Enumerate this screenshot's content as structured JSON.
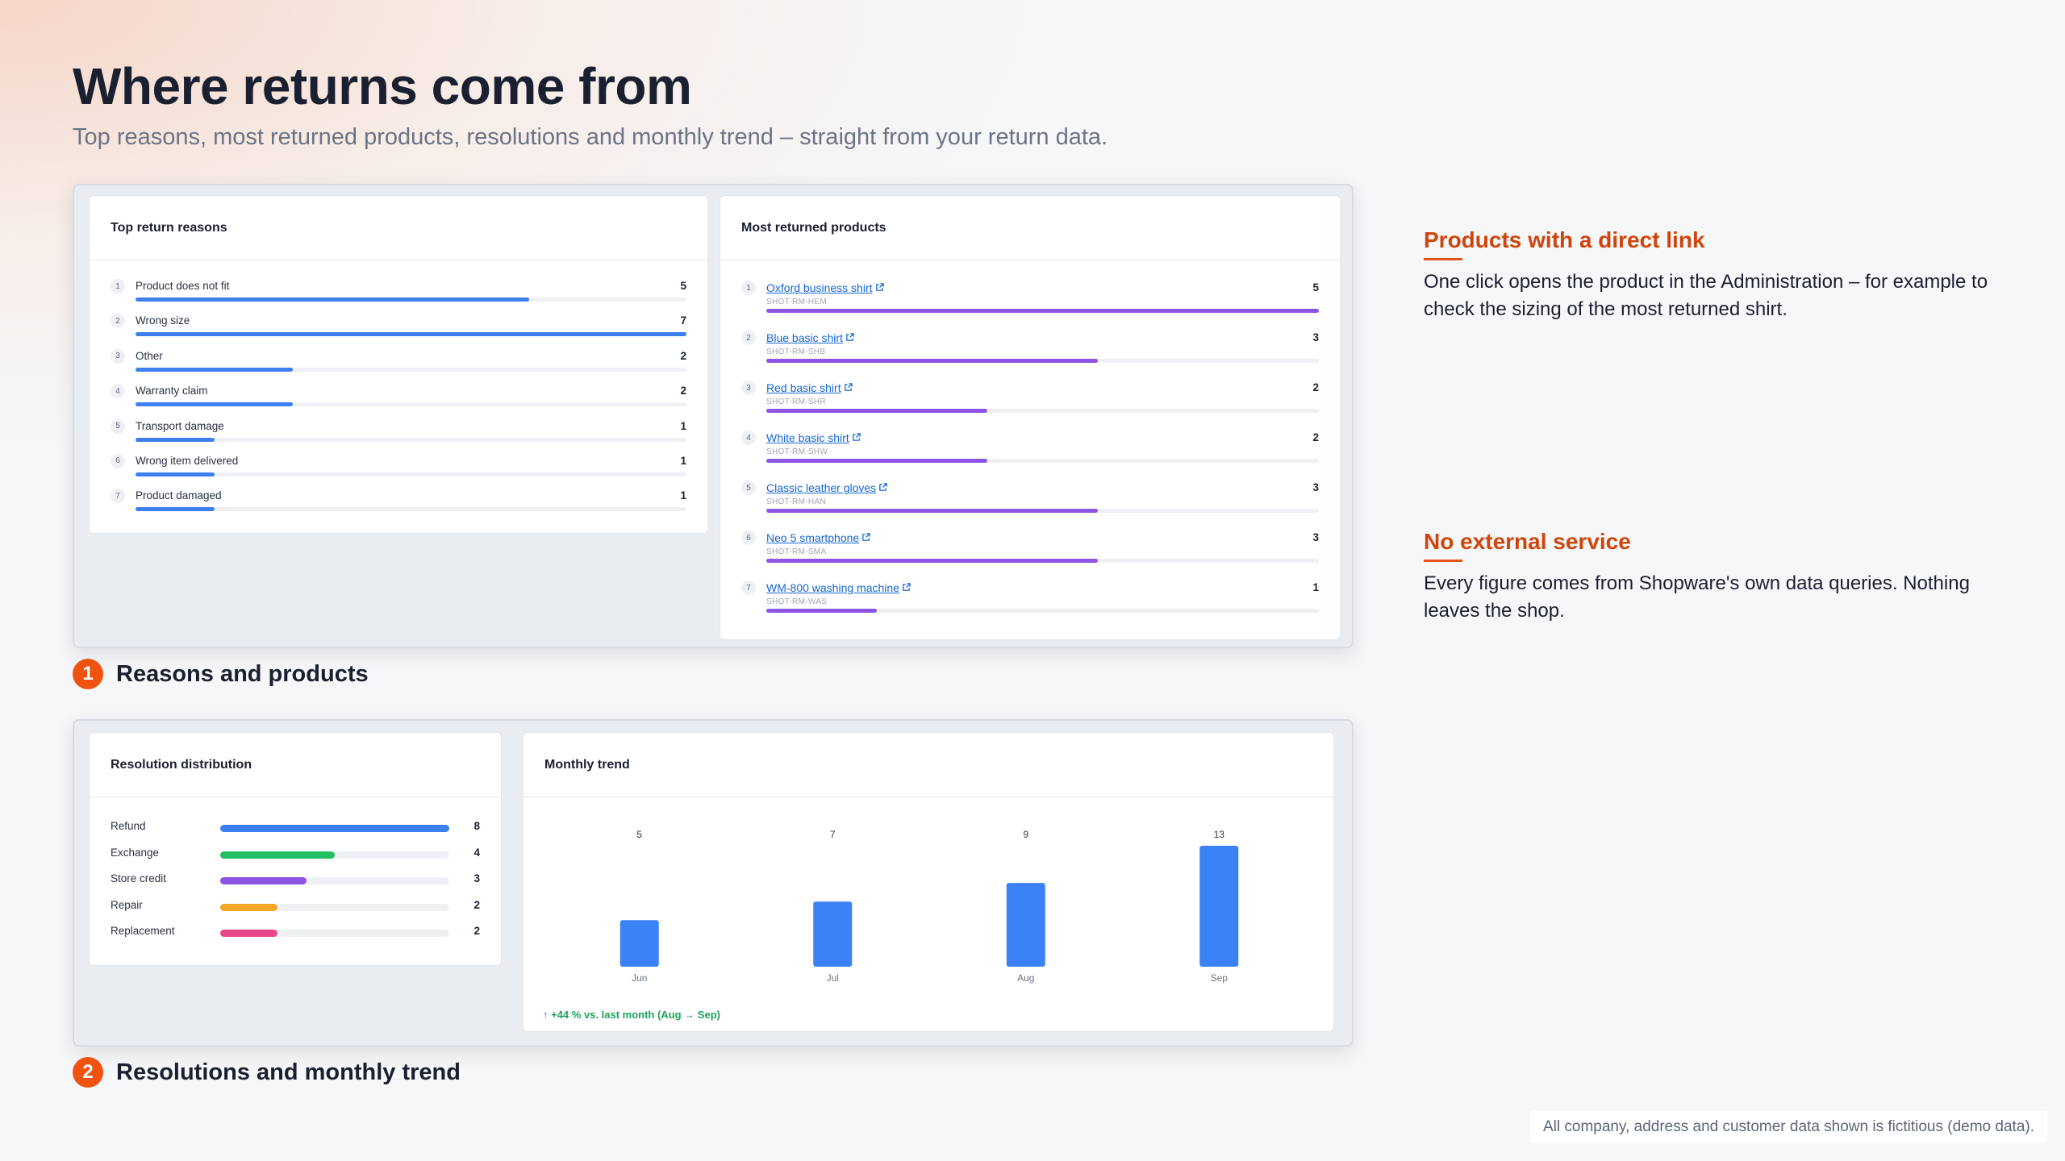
{
  "header": {
    "title": "Where returns come from",
    "subtitle": "Top reasons, most returned products, resolutions and monthly trend – straight from your return data."
  },
  "reasons": {
    "title": "Top return reasons",
    "max": 7,
    "color": "#3b7ff0",
    "items": [
      {
        "rank": "1",
        "label": "Product does not fit",
        "value": 5
      },
      {
        "rank": "2",
        "label": "Wrong size",
        "value": 7
      },
      {
        "rank": "3",
        "label": "Other",
        "value": 2
      },
      {
        "rank": "4",
        "label": "Warranty claim",
        "value": 2
      },
      {
        "rank": "5",
        "label": "Transport damage",
        "value": 1
      },
      {
        "rank": "6",
        "label": "Wrong item delivered",
        "value": 1
      },
      {
        "rank": "7",
        "label": "Product damaged",
        "value": 1
      }
    ]
  },
  "products": {
    "title": "Most returned products",
    "max": 5,
    "color": "#8d55e6",
    "items": [
      {
        "rank": "1",
        "name": "Oxford business shirt",
        "sku": "SHOT-RM-HEM",
        "value": 5
      },
      {
        "rank": "2",
        "name": "Blue basic shirt",
        "sku": "SHOT-RM-SHB",
        "value": 3
      },
      {
        "rank": "3",
        "name": "Red basic shirt",
        "sku": "SHOT-RM-SHR",
        "value": 2
      },
      {
        "rank": "4",
        "name": "White basic shirt",
        "sku": "SHOT-RM-SHW",
        "value": 2
      },
      {
        "rank": "5",
        "name": "Classic leather gloves",
        "sku": "SHOT-RM-HAN",
        "value": 3
      },
      {
        "rank": "6",
        "name": "Neo 5 smartphone",
        "sku": "SHOT-RM-SMA",
        "value": 3
      },
      {
        "rank": "7",
        "name": "WM-800 washing machine",
        "sku": "SHOT-RM-WAS",
        "value": 1
      }
    ]
  },
  "resolutions": {
    "title": "Resolution distribution",
    "max": 8,
    "items": [
      {
        "label": "Refund",
        "value": 8,
        "color": "#3b7ff0"
      },
      {
        "label": "Exchange",
        "value": 4,
        "color": "#22c062"
      },
      {
        "label": "Store credit",
        "value": 3,
        "color": "#8d55e6"
      },
      {
        "label": "Repair",
        "value": 2,
        "color": "#f5a623"
      },
      {
        "label": "Replacement",
        "value": 2,
        "color": "#e8478b"
      }
    ]
  },
  "trend": {
    "title": "Monthly trend",
    "note": "↑  +44 % vs. last month (Aug → Sep)"
  },
  "chart_data": {
    "type": "bar",
    "categories": [
      "Jun",
      "Jul",
      "Aug",
      "Sep"
    ],
    "values": [
      5,
      7,
      9,
      13
    ],
    "ylim": [
      0,
      13
    ],
    "color": "#3b82f6",
    "grid": false
  },
  "steps": [
    {
      "num": "1",
      "label": "Reasons and products"
    },
    {
      "num": "2",
      "label": "Resolutions and monthly trend"
    }
  ],
  "features": [
    {
      "title": "Products with a direct link",
      "text": "One click opens the product in the Administration – for example to check the sizing of the most returned shirt."
    },
    {
      "title": "No external service",
      "text": "Every figure comes from Shopware's own data queries. Nothing leaves the shop."
    }
  ],
  "footnote": "All company, address and customer data shown is fictitious (demo data).",
  "colors": {
    "accent": "#f0520f",
    "feature_title": "#d0450d",
    "link": "#1565d8"
  }
}
